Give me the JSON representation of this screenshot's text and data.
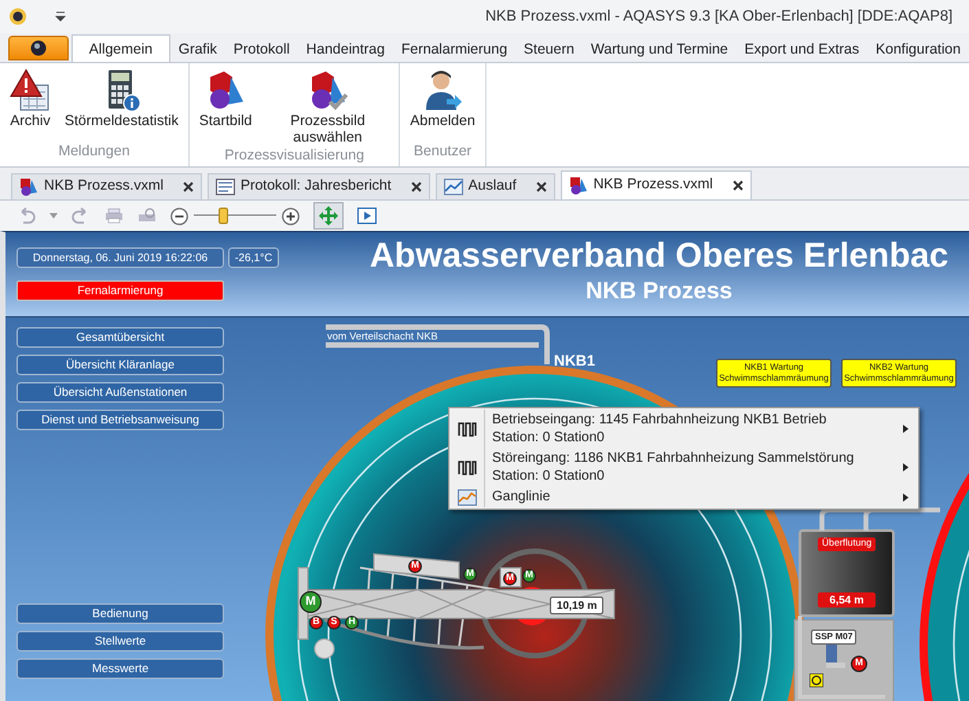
{
  "window": {
    "title": "NKB Prozess.vxml - AQASYS 9.3 [KA Ober-Erlenbach] [DDE:AQAP8]"
  },
  "ribbon": {
    "tabs": [
      {
        "label": "Allgemein",
        "selected": true
      },
      {
        "label": "Grafik",
        "selected": false
      },
      {
        "label": "Protokoll",
        "selected": false
      },
      {
        "label": "Handeintrag",
        "selected": false
      },
      {
        "label": "Fernalarmierung",
        "selected": false
      },
      {
        "label": "Steuern",
        "selected": false
      },
      {
        "label": "Wartung und Termine",
        "selected": false
      },
      {
        "label": "Export und Extras",
        "selected": false
      },
      {
        "label": "Konfiguration",
        "selected": false
      }
    ],
    "groups": [
      {
        "label": "Meldungen",
        "buttons": [
          {
            "kind": "archive",
            "label": "Archiv"
          },
          {
            "kind": "statistics",
            "label": "Störmeldestatistik"
          }
        ]
      },
      {
        "label": "Prozessvisualisierung",
        "buttons": [
          {
            "kind": "shapes",
            "label": "Startbild"
          },
          {
            "kind": "shapes-check",
            "label": "Prozessbild auswählen"
          }
        ]
      },
      {
        "label": "Benutzer",
        "buttons": [
          {
            "kind": "user",
            "label": "Abmelden"
          }
        ]
      }
    ]
  },
  "doc_tabs": [
    {
      "kind": "process",
      "label": "NKB Prozess.vxml",
      "selected": false
    },
    {
      "kind": "report",
      "label": "Protokoll: Jahresbericht",
      "selected": false
    },
    {
      "kind": "chart",
      "label": "Auslauf",
      "selected": false
    },
    {
      "kind": "process",
      "label": "NKB Prozess.vxml",
      "selected": true
    }
  ],
  "toolbar": {
    "zoom_slider": {
      "level": 0.35
    }
  },
  "canvas": {
    "date_time": "Donnerstag, 06. Juni 2019 16:22:06",
    "temperature": "-26,1°C",
    "alarm_button": "Fernalarmierung",
    "title": "Abwasserverband Oberes Erlenbac",
    "subtitle": "NKB Prozess",
    "nav_buttons": [
      "Gesamtübersicht",
      "Übersicht Kläranlage",
      "Übersicht Außenstationen",
      "Dienst und Betriebsanweisung"
    ],
    "bottom_buttons": [
      "Bedienung",
      "Stellwerte",
      "Messwerte"
    ],
    "pipe_label": "vom Verteilschacht NKB",
    "tank_label": "NKB1",
    "notices": [
      {
        "lines": [
          "NKB1 Wartung",
          "Schwimmschlammräumung"
        ]
      },
      {
        "lines": [
          "NKB2 Wartung",
          "Schwimmschlammräumung"
        ]
      }
    ],
    "indicators": [
      {
        "label": "M",
        "color": "#2e9a2e"
      },
      {
        "label": "B",
        "color": "#e01010"
      },
      {
        "label": "S",
        "color": "#e01010"
      },
      {
        "label": "H",
        "color": "#2e9a2e"
      },
      {
        "label": "M",
        "color": "#e01010"
      },
      {
        "label": "M",
        "color": "#2e9a2e"
      },
      {
        "label": "M",
        "color": "#e01010"
      },
      {
        "label": "M",
        "color": "#2e9a2e"
      },
      {
        "label": "M",
        "color": "#e01010"
      }
    ],
    "bridge_level": "10,19 m",
    "overflow_label": "Überflutung",
    "overflow_level": "6,54 m",
    "pump_label": "SSP M07",
    "context_menu": [
      {
        "kind": "pulse",
        "lines": [
          "Betriebseingang: 1145 Fahrbahnheizung NKB1 Betrieb",
          "Station: 0 Station0"
        ]
      },
      {
        "kind": "pulse",
        "lines": [
          "Störeingang: 1186 NKB1 Fahrbahnheizung Sammelstörung",
          "Station: 0 Station0"
        ]
      },
      {
        "kind": "chart",
        "lines": [
          "Ganglinie"
        ]
      }
    ]
  }
}
